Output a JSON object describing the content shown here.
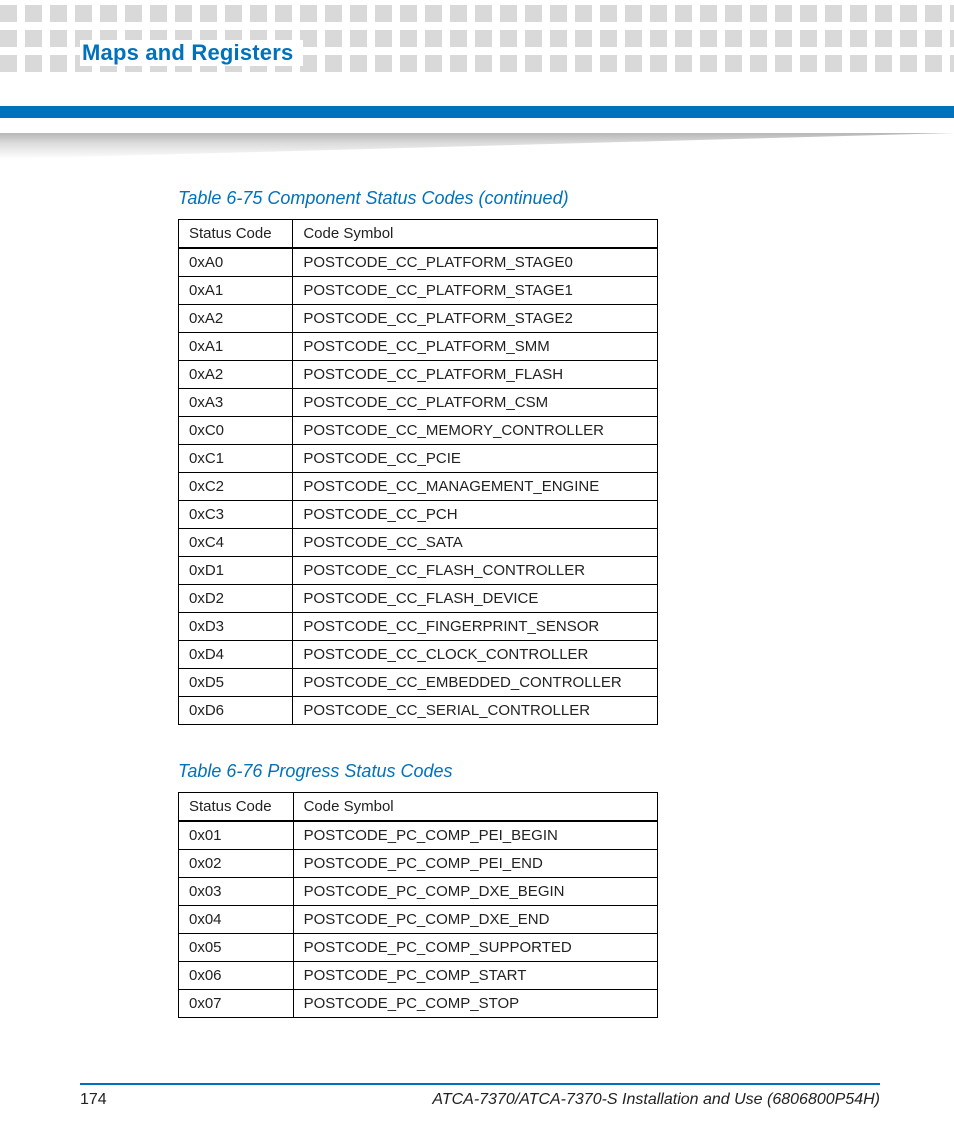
{
  "header": {
    "section_title": "Maps and Registers"
  },
  "table1": {
    "caption": "Table 6-75 Component Status Codes (continued)",
    "columns": {
      "c1": "Status Code",
      "c2": "Code Symbol"
    },
    "rows": [
      {
        "code": "0xA0",
        "sym": "POSTCODE_CC_PLATFORM_STAGE0"
      },
      {
        "code": "0xA1",
        "sym": "POSTCODE_CC_PLATFORM_STAGE1"
      },
      {
        "code": "0xA2",
        "sym": "POSTCODE_CC_PLATFORM_STAGE2"
      },
      {
        "code": "0xA1",
        "sym": "POSTCODE_CC_PLATFORM_SMM"
      },
      {
        "code": "0xA2",
        "sym": "POSTCODE_CC_PLATFORM_FLASH"
      },
      {
        "code": "0xA3",
        "sym": "POSTCODE_CC_PLATFORM_CSM"
      },
      {
        "code": "0xC0",
        "sym": "POSTCODE_CC_MEMORY_CONTROLLER"
      },
      {
        "code": "0xC1",
        "sym": "POSTCODE_CC_PCIE"
      },
      {
        "code": "0xC2",
        "sym": "POSTCODE_CC_MANAGEMENT_ENGINE"
      },
      {
        "code": "0xC3",
        "sym": "POSTCODE_CC_PCH"
      },
      {
        "code": "0xC4",
        "sym": "POSTCODE_CC_SATA"
      },
      {
        "code": "0xD1",
        "sym": "POSTCODE_CC_FLASH_CONTROLLER"
      },
      {
        "code": "0xD2",
        "sym": "POSTCODE_CC_FLASH_DEVICE"
      },
      {
        "code": "0xD3",
        "sym": "POSTCODE_CC_FINGERPRINT_SENSOR"
      },
      {
        "code": "0xD4",
        "sym": "POSTCODE_CC_CLOCK_CONTROLLER"
      },
      {
        "code": "0xD5",
        "sym": "POSTCODE_CC_EMBEDDED_CONTROLLER"
      },
      {
        "code": "0xD6",
        "sym": "POSTCODE_CC_SERIAL_CONTROLLER"
      }
    ]
  },
  "table2": {
    "caption": "Table 6-76 Progress Status Codes",
    "columns": {
      "c1": "Status Code",
      "c2": "Code Symbol"
    },
    "rows": [
      {
        "code": "0x01",
        "sym": "POSTCODE_PC_COMP_PEI_BEGIN"
      },
      {
        "code": "0x02",
        "sym": "POSTCODE_PC_COMP_PEI_END"
      },
      {
        "code": "0x03",
        "sym": "POSTCODE_PC_COMP_DXE_BEGIN"
      },
      {
        "code": "0x04",
        "sym": "POSTCODE_PC_COMP_DXE_END"
      },
      {
        "code": "0x05",
        "sym": "POSTCODE_PC_COMP_SUPPORTED"
      },
      {
        "code": "0x06",
        "sym": "POSTCODE_PC_COMP_START"
      },
      {
        "code": "0x07",
        "sym": "POSTCODE_PC_COMP_STOP"
      }
    ]
  },
  "footer": {
    "page_number": "174",
    "doc_title": "ATCA-7370/ATCA-7370-S Installation and Use (6806800P54H)"
  }
}
